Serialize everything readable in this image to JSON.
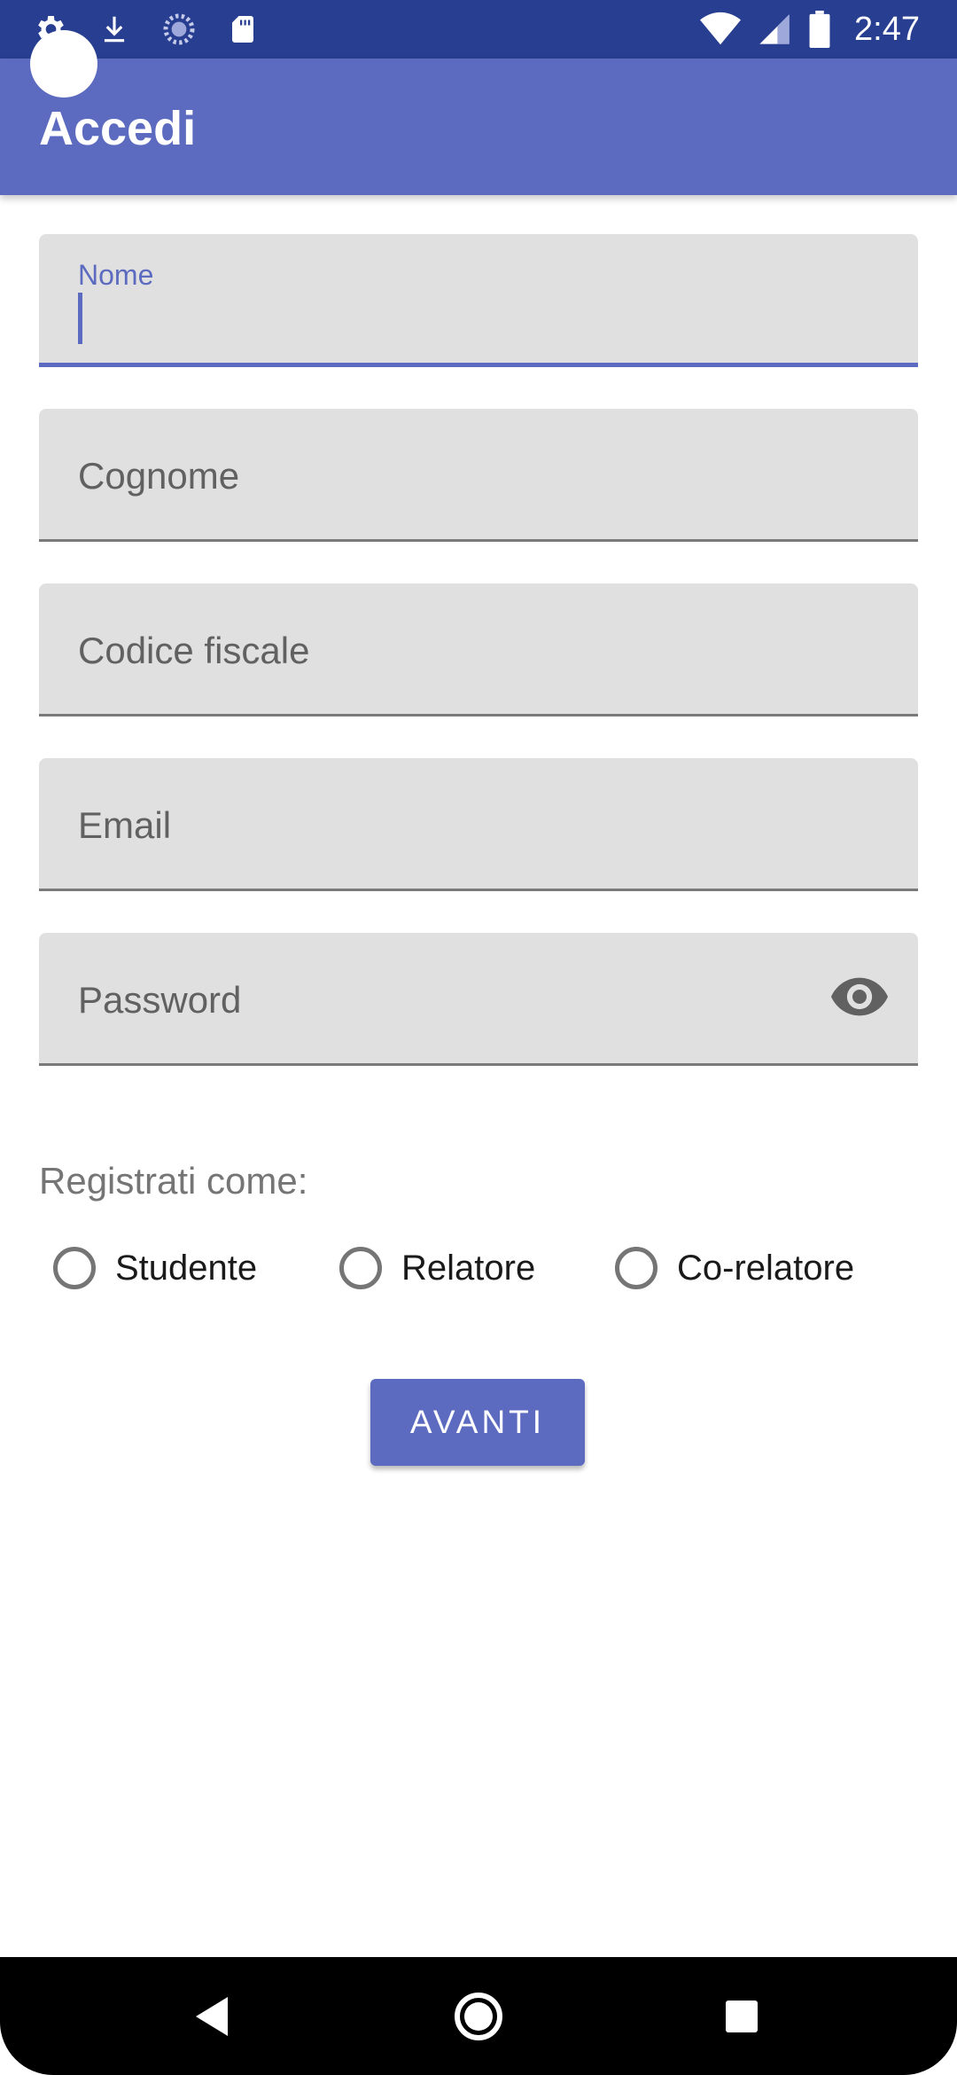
{
  "status_bar": {
    "time": "2:47",
    "left_icons": [
      "settings-icon",
      "download-icon",
      "sync-icon",
      "sd-card-icon"
    ],
    "right_icons": [
      "wifi-icon",
      "signal-icon",
      "battery-icon"
    ]
  },
  "app_bar": {
    "title": "Accedi"
  },
  "form": {
    "fields": [
      {
        "label": "Nome",
        "value": "",
        "focused": true
      },
      {
        "label": "Cognome",
        "value": ""
      },
      {
        "label": "Codice fiscale",
        "value": ""
      },
      {
        "label": "Email",
        "value": ""
      },
      {
        "label": "Password",
        "value": "",
        "icon": "eye-icon"
      }
    ],
    "role_label": "Registrati come:",
    "roles": [
      "Studente",
      "Relatore",
      "Co-relatore"
    ],
    "submit_label": "AVANTI"
  },
  "colors": {
    "primary": "#5c6bc0",
    "status_bar": "#283f91",
    "field_bg": "#e0e0e0"
  },
  "nav_bar": {
    "buttons": [
      "back-icon",
      "home-icon",
      "recents-icon"
    ]
  }
}
